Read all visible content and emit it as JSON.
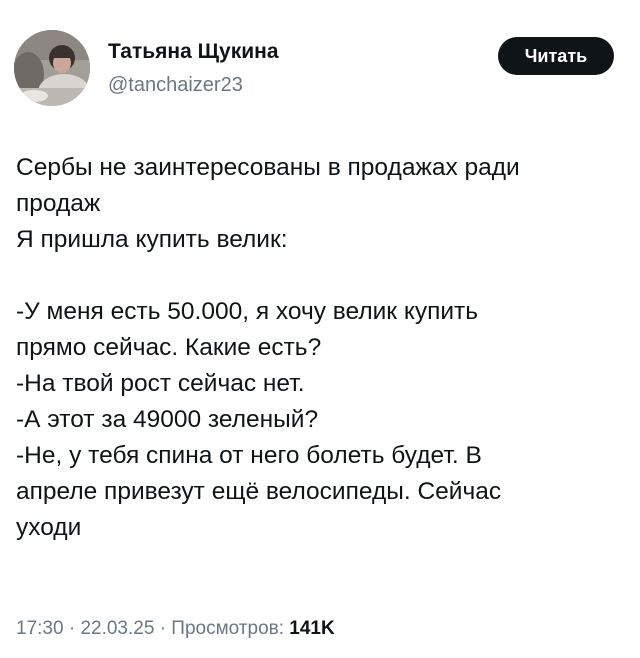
{
  "author": {
    "name": "Татьяна Щукина",
    "handle": "@tanchaizer23"
  },
  "follow_button": {
    "label": "Читать"
  },
  "tweet": {
    "lines": [
      "Сербы не заинтересованы в продажах ради",
      "продаж",
      "Я пришла купить велик:",
      "",
      "-У меня есть 50.000, я хочу велик купить",
      "прямо сейчас. Какие есть?",
      "-На твой рост сейчас нет.",
      "-А этот за 49000 зеленый?",
      "-Не, у тебя спина от него болеть будет. В",
      "апреле привезут ещё велосипеды. Сейчас",
      "уходи"
    ]
  },
  "meta": {
    "time": "17:30",
    "separator": "·",
    "date": "22.03.25",
    "views_label": "Просмотров:",
    "views_count": "141K"
  },
  "colors": {
    "text": "#0f1419",
    "secondary_text": "#6b7785",
    "button_bg": "#0f1419",
    "button_text": "#ffffff"
  }
}
